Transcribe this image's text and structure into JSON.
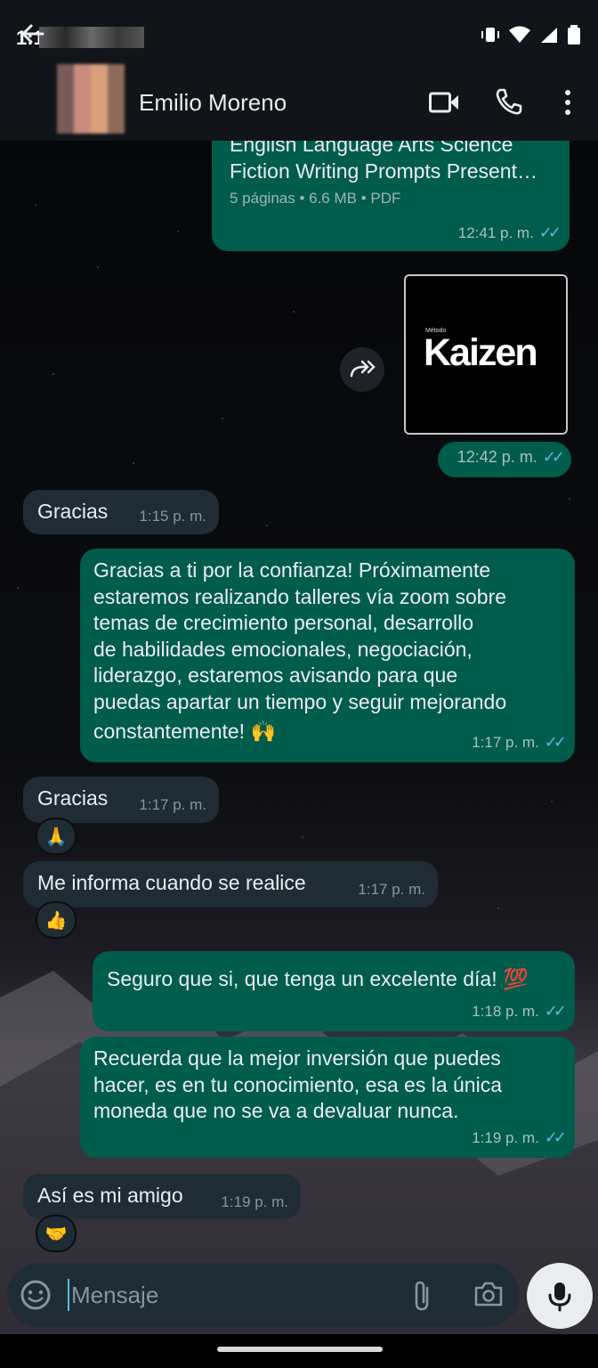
{
  "status": {
    "time": "1:1"
  },
  "header": {
    "contact_name": "Emilio Moreno"
  },
  "messages": {
    "doc": {
      "title_line1": "English Language Arts Science",
      "title_line2": "Fiction Writing Prompts Present…",
      "details": "5 páginas • 6.6 MB • PDF",
      "time": "12:41 p. m."
    },
    "image": {
      "small_label": "Método",
      "brand": "Kaizen",
      "time": "12:42 p. m."
    },
    "m1": {
      "text": "Gracias",
      "time": "1:15 p. m."
    },
    "m2": {
      "lines": [
        "Gracias a ti por la confianza! Próximamente",
        "estaremos realizando talleres vía zoom sobre",
        "temas de crecimiento personal, desarrollo",
        "de habilidades emocionales, negociación,",
        "liderazgo, estaremos avisando para que",
        "puedas apartar un tiempo y seguir mejorando",
        "constantemente! 🙌"
      ],
      "time": "1:17 p. m."
    },
    "m3": {
      "text": "Gracias",
      "time": "1:17 p. m.",
      "reaction": "🙏"
    },
    "m4": {
      "text": "Me informa cuando se realice",
      "time": "1:17 p. m.",
      "reaction": "👍"
    },
    "m5": {
      "text": "Seguro que si, que tenga un excelente día! 💯",
      "time": "1:18 p. m."
    },
    "m6": {
      "lines": [
        "Recuerda que la mejor inversión que puedes",
        "hacer, es en tu conocimiento, esa es la única",
        "moneda que no se va a devaluar nunca."
      ],
      "time": "1:19 p. m."
    },
    "m7": {
      "text": "Así es mi amigo",
      "time": "1:19 p. m.",
      "reaction": "🤝"
    }
  },
  "input": {
    "placeholder": "Mensaje"
  },
  "colors": {
    "outgoing": "#005c4b",
    "incoming": "#1f2c34",
    "ticks": "#53bdeb"
  }
}
